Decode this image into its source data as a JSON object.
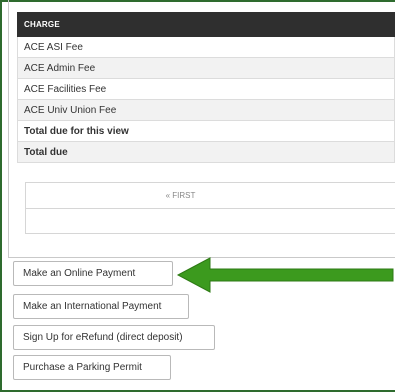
{
  "charges": {
    "header": "CHARGE",
    "rows": [
      "ACE ASI Fee",
      "ACE Admin Fee",
      "ACE Facilities Fee",
      "ACE Univ Union Fee"
    ],
    "total_view": "Total due for this view",
    "total_due": "Total due"
  },
  "pager": {
    "first_label": "« FIRST"
  },
  "actions": {
    "online_payment": "Make an Online Payment",
    "international_payment": "Make an International Payment",
    "erefund": "Sign Up for eRefund (direct deposit)",
    "parking": "Purchase a Parking Permit"
  },
  "annotation": {
    "arrow_color": "#3c9a1e",
    "arrow_icon": "arrow-left-icon"
  }
}
